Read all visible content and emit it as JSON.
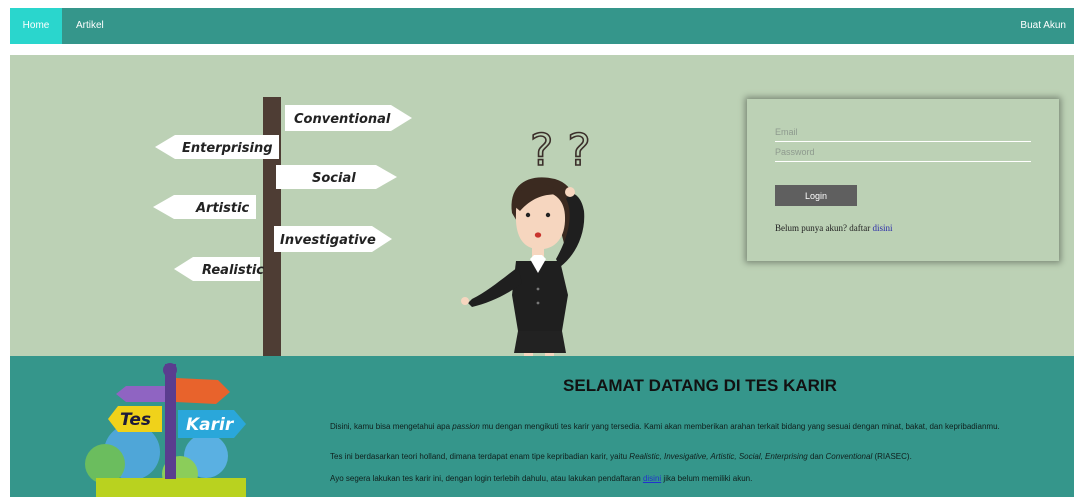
{
  "nav": {
    "home": "Home",
    "artikel": "Artikel",
    "buat_akun": "Buat Akun"
  },
  "hero": {
    "signs": [
      "Conventional",
      "Enterprising",
      "Social",
      "Artistic",
      "Investigative",
      "Realistic"
    ],
    "question_marks": "? ?"
  },
  "login": {
    "email_placeholder": "Email",
    "password_placeholder": "Password",
    "button_label": "Login",
    "register_prefix": "Belum punya akun? daftar ",
    "register_link": "disini"
  },
  "logo": {
    "left_word": "Tes",
    "right_word": "Karir"
  },
  "welcome": {
    "title": "SELAMAT DATANG DI TES KARIR",
    "p1_a": "Disini, kamu bisa mengetahui apa ",
    "p1_em": "passion",
    "p1_b": " mu dengan mengikuti tes karir yang tersedia. Kami akan memberikan arahan terkait bidang yang sesuai dengan minat, bakat, dan kepribadianmu.",
    "p2_a": "Tes ini berdasarkan teori holland, dimana terdapat enam tipe kepribadian karir, yaitu ",
    "p2_em": "Realistic, Invesigative, Artistic, Social, Enterprising",
    "p2_and": " dan ",
    "p2_em2": "Conventional",
    "p2_b": " (RIASEC).",
    "p3_a": "Ayo segera lakukan tes karir ini, dengan login terlebih dahulu, atau lakukan pendaftaran ",
    "p3_link": "disini",
    "p3_b": " jika belum memiliki akun."
  }
}
